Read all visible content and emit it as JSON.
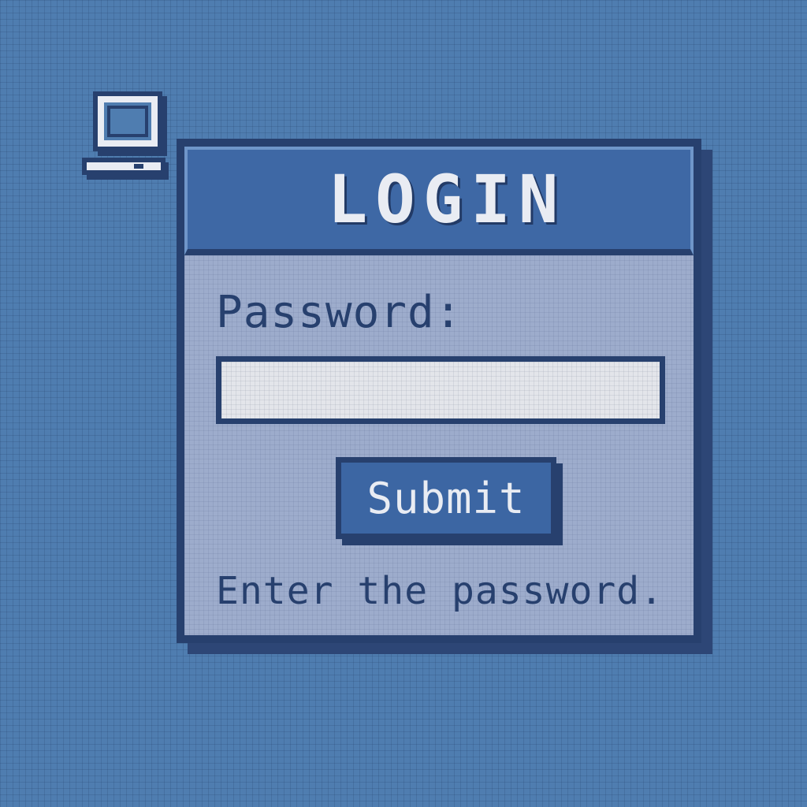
{
  "desktop": {
    "icon": "computer-icon"
  },
  "login_window": {
    "title": "LOGIN",
    "password_label": "Password:",
    "password_value": "",
    "submit_label": "Submit",
    "hint": "Enter the password."
  },
  "colors": {
    "desktop_background": "#4f7db0",
    "window_background": "#9daccc",
    "titlebar": "#3e68a5",
    "border": "#27406e",
    "text_light": "#e9ecf3",
    "input_background": "#e3e5ea"
  }
}
